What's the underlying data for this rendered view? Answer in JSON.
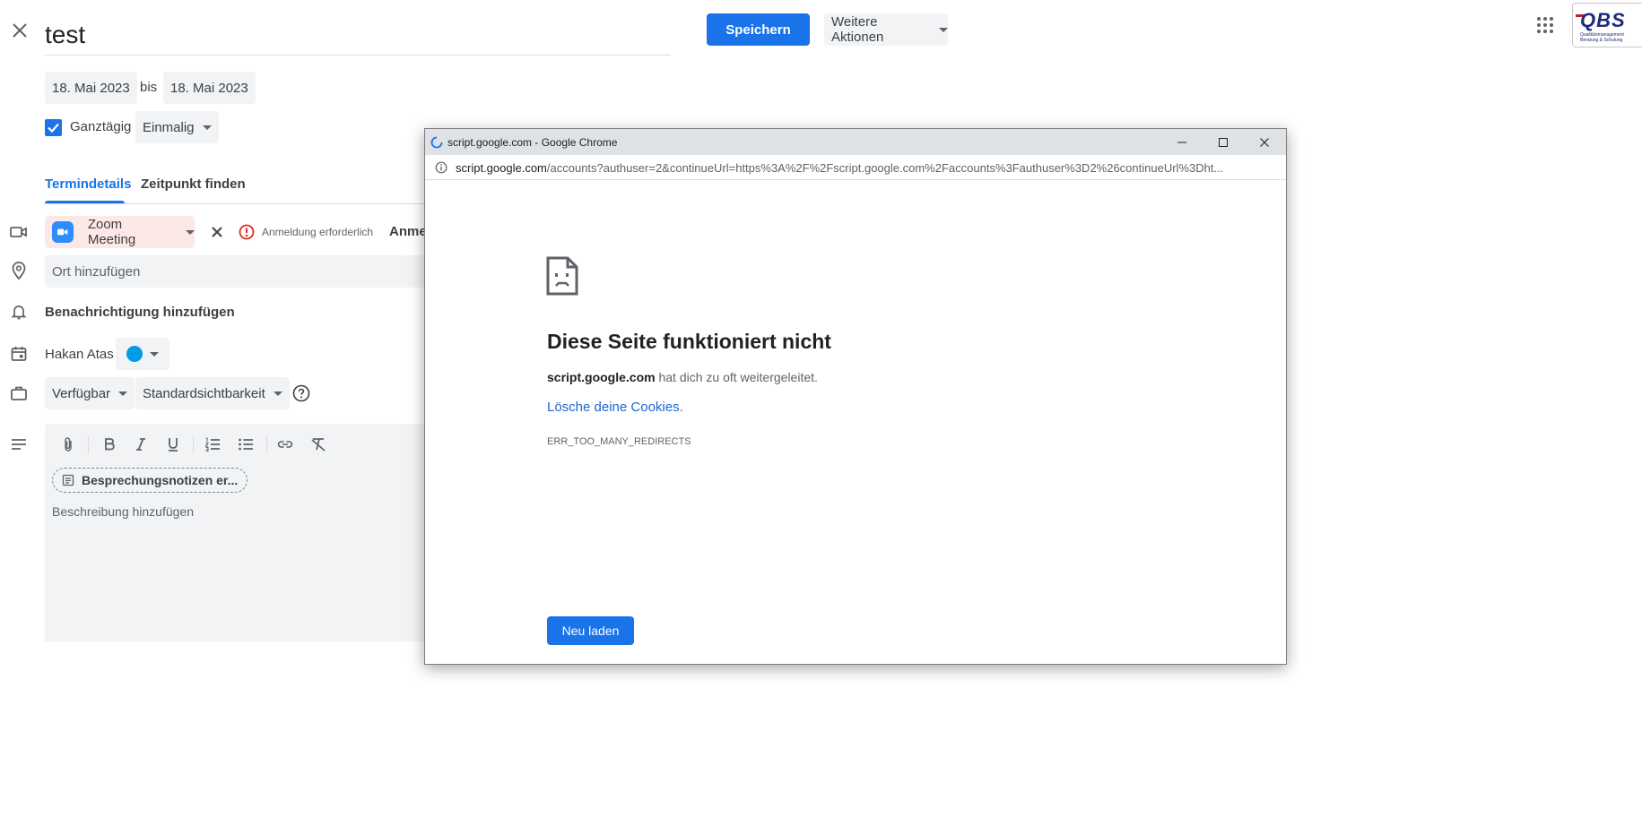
{
  "event": {
    "title": "test",
    "save_label": "Speichern",
    "more_actions_label": "Weitere Aktionen",
    "date_start": "18. Mai 2023",
    "date_separator": "bis",
    "date_end": "18. Mai 2023",
    "all_day_label": "Ganztägig",
    "all_day_checked": true,
    "repeat_label": "Einmalig"
  },
  "logo": {
    "text": "QBS",
    "subtext": "Qualitätsmanagement Beratung & Schulung"
  },
  "tabs": [
    {
      "label": "Termindetails",
      "active": true
    },
    {
      "label": "Zeitpunkt finden",
      "active": false
    }
  ],
  "conference": {
    "label": "Zoom Meeting",
    "alert_text": "Anmeldung erforderlich",
    "signin_link": "Anme"
  },
  "location_placeholder": "Ort hinzufügen",
  "notification_label": "Benachrichtigung hinzufügen",
  "calendar": {
    "owner": "Hakan Atas",
    "color": "#039be5"
  },
  "availability": "Verfügbar",
  "visibility": "Standardsichtbarkeit",
  "description": {
    "notes_chip": "Besprechungsnotizen er...",
    "placeholder": "Beschreibung hinzufügen"
  },
  "popup": {
    "window_title": "script.google.com - Google Chrome",
    "url_host": "script.google.com",
    "url_path": "/accounts?authuser=2&continueUrl=https%3A%2F%2Fscript.google.com%2Faccounts%3Fauthuser%3D2%26continueUrl%3Dht...",
    "error_heading": "Diese Seite funktioniert nicht",
    "error_host": "script.google.com",
    "error_message": " hat dich zu oft weitergeleitet.",
    "clear_cookies_link": "Lösche deine Cookies",
    "link_suffix": ".",
    "error_code": "ERR_TOO_MANY_REDIRECTS",
    "reload_label": "Neu laden"
  },
  "colors": {
    "primary": "#1a73e8",
    "zoom_chip_bg": "#fce8e6",
    "zoom_blue": "#2d8cff",
    "alert_red": "#d93025"
  }
}
